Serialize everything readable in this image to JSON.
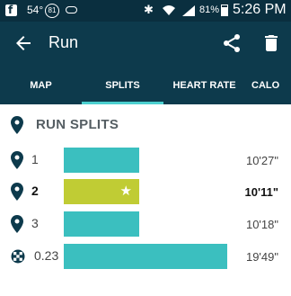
{
  "status_bar": {
    "temperature": "54°",
    "notification_badge": "81",
    "battery_percent": "81%",
    "time": "5:26 PM"
  },
  "app_bar": {
    "title": "Run"
  },
  "tabs": [
    {
      "label": "MAP",
      "active": false
    },
    {
      "label": "SPLITS",
      "active": true
    },
    {
      "label": "HEART RATE",
      "active": false
    },
    {
      "label": "CALO",
      "active": false
    }
  ],
  "section": {
    "title": "RUN SPLITS"
  },
  "splits": [
    {
      "label": "1",
      "pace": "10'27\"",
      "best": false,
      "icon": "map-pin-icon"
    },
    {
      "label": "2",
      "pace": "10'11\"",
      "best": true,
      "icon": "map-pin-icon"
    },
    {
      "label": "3",
      "pace": "10'18\"",
      "best": false,
      "icon": "map-pin-icon"
    },
    {
      "label": "0.23",
      "pace": "19'49\"",
      "best": false,
      "icon": "finish-flag-icon"
    }
  ],
  "colors": {
    "app_bar": "#0d3a4c",
    "status_bar": "#0a2f3f",
    "tab_indicator": "#4ccfcf",
    "bar": "#3bbfbf",
    "best_bar": "#c0cc34"
  }
}
